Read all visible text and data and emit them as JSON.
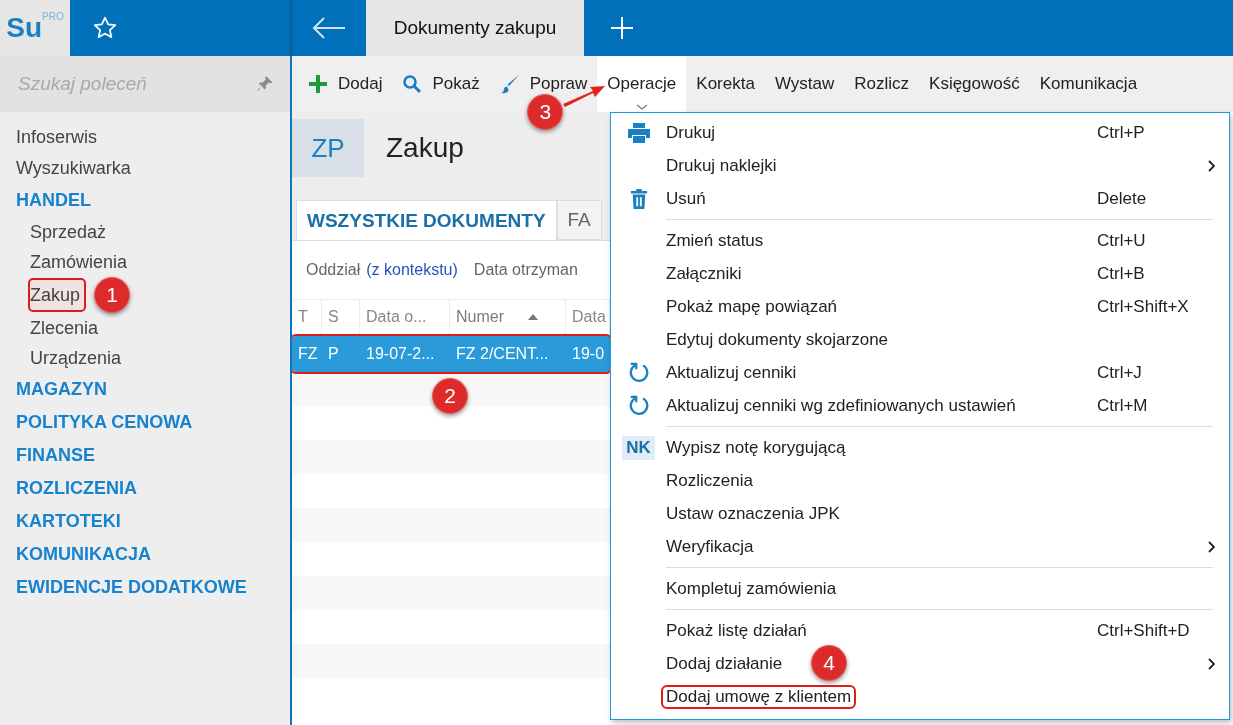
{
  "logo": {
    "text": "Su",
    "superscript": "PRO"
  },
  "tabs": [
    {
      "label": "Dokumenty zakupu",
      "selected": true
    }
  ],
  "search": {
    "placeholder": "Szukaj poleceń"
  },
  "sidebar": {
    "items": [
      {
        "label": "Infoserwis",
        "kind": "link"
      },
      {
        "label": "Wyszukiwarka",
        "kind": "link"
      },
      {
        "label": "HANDEL",
        "kind": "section",
        "children": [
          {
            "label": "Sprzedaż",
            "annotated": false
          },
          {
            "label": "Zamówienia",
            "annotated": false
          },
          {
            "label": "Zakup",
            "annotated": true,
            "callout": "1"
          },
          {
            "label": "Zlecenia",
            "annotated": false
          },
          {
            "label": "Urządzenia",
            "annotated": false
          }
        ]
      },
      {
        "label": "MAGAZYN",
        "kind": "section"
      },
      {
        "label": "POLITYKA CENOWA",
        "kind": "section"
      },
      {
        "label": "FINANSE",
        "kind": "section"
      },
      {
        "label": "ROZLICZENIA",
        "kind": "section"
      },
      {
        "label": "KARTOTEKI",
        "kind": "section"
      },
      {
        "label": "KOMUNIKACJA",
        "kind": "section"
      },
      {
        "label": "EWIDENCJE DODATKOWE",
        "kind": "section"
      }
    ]
  },
  "toolbar": [
    {
      "label": "Dodaj",
      "kind": "add",
      "selected": false
    },
    {
      "label": "Pokaż",
      "kind": "view",
      "selected": false
    },
    {
      "label": "Popraw",
      "kind": "edit",
      "selected": false
    },
    {
      "label": "Operacje",
      "kind": "menu",
      "selected": true,
      "callout": "3"
    },
    {
      "label": "Korekta",
      "kind": "menu",
      "selected": false
    },
    {
      "label": "Wystaw",
      "kind": "menu",
      "selected": false
    },
    {
      "label": "Rozlicz",
      "kind": "menu",
      "selected": false
    },
    {
      "label": "Księgowość",
      "kind": "menu",
      "selected": false
    },
    {
      "label": "Komunikacja",
      "kind": "menu",
      "selected": false
    }
  ],
  "header": {
    "badge": "ZP",
    "title": "Zakup"
  },
  "doc_tabs": [
    {
      "label": "WSZYSTKIE DOKUMENTY",
      "selected": true
    },
    {
      "label": "FA",
      "selected": false
    }
  ],
  "filter": {
    "label": "Oddział",
    "link": "(z kontekstu)",
    "next": "Data otrzyman"
  },
  "table": {
    "columns": [
      {
        "label": "T"
      },
      {
        "label": "S"
      },
      {
        "label": "Data o..."
      },
      {
        "label": "Numer",
        "sorted": true
      },
      {
        "label": "Data"
      }
    ],
    "rows": [
      {
        "cells": [
          "FZ",
          "P",
          "19-07-2...",
          "FZ 2/CENT...",
          "19-0"
        ],
        "selected": true,
        "annotated": true,
        "callout": "2"
      }
    ]
  },
  "menu": [
    {
      "kind": "print",
      "label": "Drukuj",
      "shortcut": "Ctrl+P"
    },
    {
      "kind": "plain",
      "label": "Drukuj naklejki",
      "submenu": true
    },
    {
      "kind": "delete",
      "label": "Usuń",
      "shortcut": "Delete"
    },
    {
      "kind": "separator"
    },
    {
      "kind": "plain",
      "label": "Zmień status",
      "shortcut": "Ctrl+U"
    },
    {
      "kind": "plain",
      "label": "Załączniki",
      "shortcut": "Ctrl+B"
    },
    {
      "kind": "plain",
      "label": "Pokaż mapę powiązań",
      "shortcut": "Ctrl+Shift+X"
    },
    {
      "kind": "plain",
      "label": "Edytuj dokumenty skojarzone"
    },
    {
      "kind": "refresh",
      "label": "Aktualizuj cenniki",
      "shortcut": "Ctrl+J"
    },
    {
      "kind": "refresh",
      "label": "Aktualizuj cenniki wg zdefiniowanych ustawień",
      "shortcut": "Ctrl+M"
    },
    {
      "kind": "separator"
    },
    {
      "kind": "note",
      "label": "Wypisz notę korygującą",
      "badge": "NK"
    },
    {
      "kind": "plain",
      "label": "Rozliczenia"
    },
    {
      "kind": "plain",
      "label": "Ustaw oznaczenia JPK"
    },
    {
      "kind": "plain",
      "label": "Weryfikacja",
      "submenu": true
    },
    {
      "kind": "separator"
    },
    {
      "kind": "plain",
      "label": "Kompletuj zamówienia"
    },
    {
      "kind": "separator"
    },
    {
      "kind": "plain",
      "label": "Pokaż listę działań",
      "shortcut": "Ctrl+Shift+D"
    },
    {
      "kind": "plain",
      "label": "Dodaj działanie",
      "submenu": true,
      "callout": "4"
    },
    {
      "kind": "plain",
      "label": "Dodaj umowę z klientem",
      "annotated": true
    }
  ]
}
